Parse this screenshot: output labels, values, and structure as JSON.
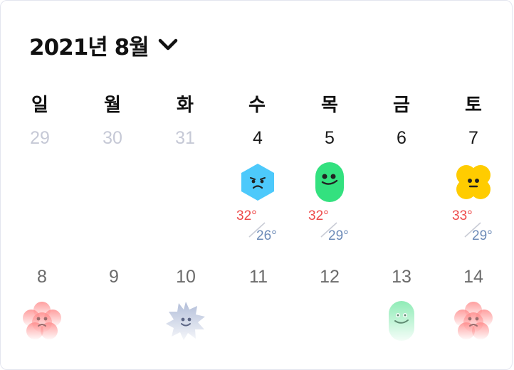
{
  "header": {
    "month_label": "2021년 8월",
    "dropdown_icon": "chevron-down-icon"
  },
  "weekdays": [
    "일",
    "월",
    "화",
    "수",
    "목",
    "금",
    "토"
  ],
  "week1": [
    {
      "day": "29",
      "state": "other-month"
    },
    {
      "day": "30",
      "state": "other-month"
    },
    {
      "day": "31",
      "state": "other-month"
    },
    {
      "day": "4",
      "state": "current",
      "mascot": "blue-hexagon-sad-icon",
      "high": "32°",
      "low": "26°"
    },
    {
      "day": "5",
      "state": "current",
      "mascot": "green-capsule-smile-icon",
      "high": "32°",
      "low": "29°"
    },
    {
      "day": "6",
      "state": "current"
    },
    {
      "day": "7",
      "state": "current",
      "mascot": "yellow-flower-neutral-icon",
      "high": "33°",
      "low": "29°"
    }
  ],
  "week2": [
    {
      "day": "8",
      "state": "future",
      "mascot": "pink-flower-sad-icon"
    },
    {
      "day": "9",
      "state": "future"
    },
    {
      "day": "10",
      "state": "future",
      "mascot": "gray-spiky-smile-icon"
    },
    {
      "day": "11",
      "state": "future"
    },
    {
      "day": "12",
      "state": "future"
    },
    {
      "day": "13",
      "state": "future",
      "mascot": "green-capsule-smile-icon"
    },
    {
      "day": "14",
      "state": "future",
      "mascot": "pink-flower-sad-icon"
    }
  ],
  "colors": {
    "text": "#111111",
    "muted_day": "#c6c9d6",
    "future_day": "#6b6b6b",
    "temp_high": "#ee4a4a",
    "temp_low": "#6d8bb8",
    "mascot_blue": "#4dc9fb",
    "mascot_green": "#33e17f",
    "mascot_yellow": "#ffcc00",
    "mascot_pink": "#ff8e8e",
    "mascot_gray": "#b4bfd8",
    "border": "#e3e5ef"
  }
}
